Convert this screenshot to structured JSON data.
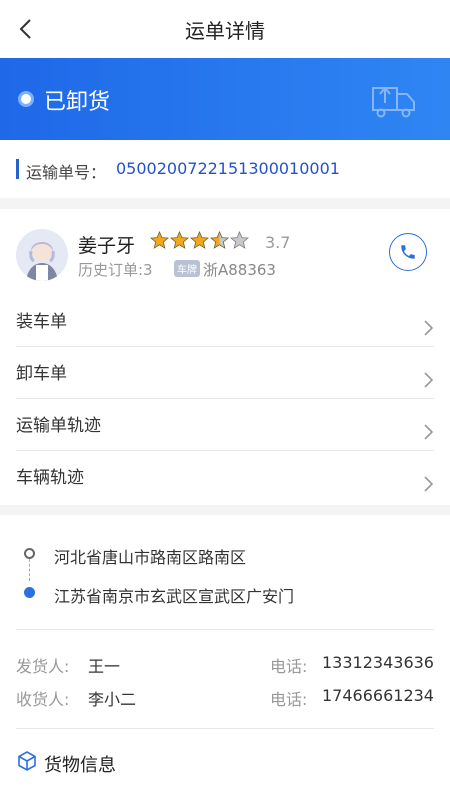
{
  "header": {
    "title": "运单详情"
  },
  "status": {
    "text": "已卸货"
  },
  "waybill": {
    "label": "运输单号：",
    "number": "0500200722151300010001"
  },
  "driver": {
    "name": "姜子牙",
    "rating": "3.7",
    "rating_value": 3.7,
    "history": "历史订单:3",
    "plate_tag": "车牌",
    "plate": "浙A88363"
  },
  "menu": [
    {
      "label": "装车单"
    },
    {
      "label": "卸车单"
    },
    {
      "label": "运输单轨迹"
    },
    {
      "label": "车辆轨迹"
    }
  ],
  "route": {
    "from": "河北省唐山市路南区路南区",
    "to": "江苏省南京市玄武区宣武区广安门"
  },
  "shipper": {
    "label": "发货人:",
    "name": "王一",
    "phone_label": "电话:",
    "phone": "13312343636"
  },
  "receiver": {
    "label": "收货人:",
    "name": "李小二",
    "phone_label": "电话:",
    "phone": "17466661234"
  },
  "goods": {
    "title": "货物信息"
  },
  "colors": {
    "primary": "#1f68e8",
    "accent_text": "#2452c9",
    "star": "#f2a81d"
  }
}
